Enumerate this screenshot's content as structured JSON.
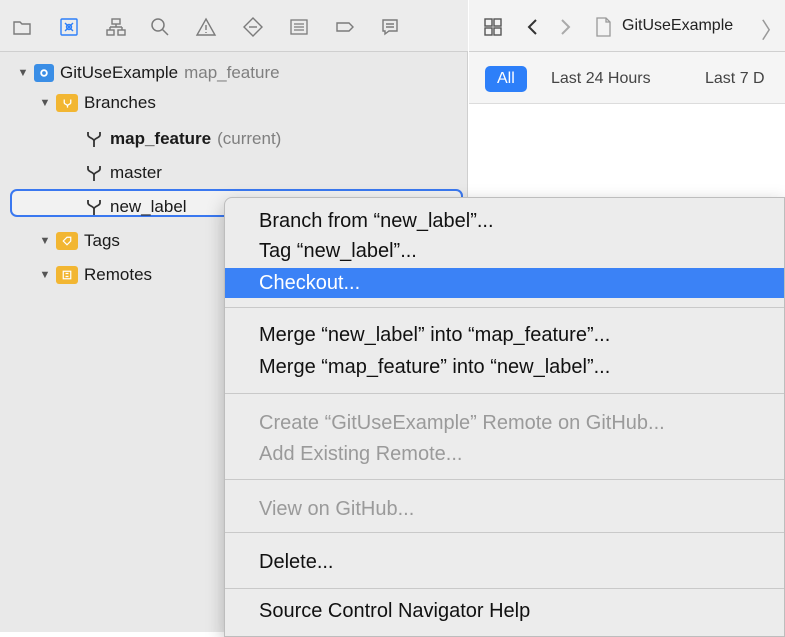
{
  "toolbar": {
    "icons": [
      "folder-icon",
      "source-control-icon",
      "hierarchy-icon",
      "search-icon",
      "warning-icon",
      "test-icon",
      "debug-icon",
      "breakpoint-icon",
      "report-icon"
    ]
  },
  "editor": {
    "breadcrumb": "GitUseExample",
    "filters": [
      "All",
      "Last 24 Hours",
      "Last 7 D"
    ]
  },
  "tree": {
    "repo_name": "GitUseExample",
    "repo_branch": "map_feature",
    "branches_label": "Branches",
    "branches": [
      {
        "name": "map_feature",
        "suffix": "(current)"
      },
      {
        "name": "master",
        "suffix": ""
      },
      {
        "name": "new_label",
        "suffix": ""
      }
    ],
    "tags_label": "Tags",
    "remotes_label": "Remotes"
  },
  "menu": {
    "items": [
      {
        "label": "Branch from “new_label”...",
        "enabled": true
      },
      {
        "label": "Tag “new_label”...",
        "enabled": true
      },
      {
        "label": "Checkout...",
        "enabled": true,
        "highlighted": true
      },
      {
        "label": "Merge “new_label” into “map_feature”...",
        "enabled": true
      },
      {
        "label": "Merge “map_feature” into “new_label”...",
        "enabled": true
      },
      {
        "label": "Create “GitUseExample” Remote on GitHub...",
        "enabled": false
      },
      {
        "label": "Add Existing Remote...",
        "enabled": false
      },
      {
        "label": "View on GitHub...",
        "enabled": false
      },
      {
        "label": "Delete...",
        "enabled": true
      },
      {
        "label": "Source Control Navigator Help",
        "enabled": true
      }
    ]
  },
  "colors": {
    "accent": "#2d7ff9",
    "highlight": "#3b82f6",
    "folder_yellow": "#f2b632",
    "repo_blue": "#3a8ee6"
  }
}
